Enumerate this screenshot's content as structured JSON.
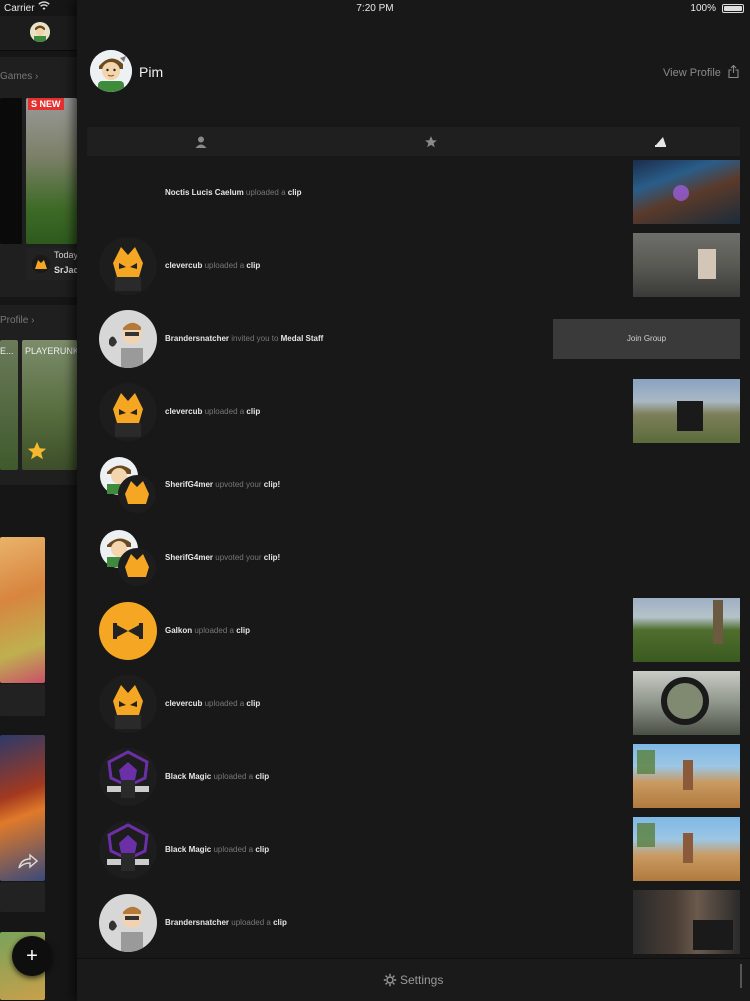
{
  "status_bar": {
    "carrier": "Carrier",
    "time": "7:20 PM",
    "battery": "100%"
  },
  "left": {
    "games_link": "Games",
    "new_badge": "S NEW",
    "today_label": "Today",
    "user_short": "SrJac",
    "profile_link": "Profile",
    "clip_title": "PLAYERUNK",
    "clip_title_left": "E..."
  },
  "panel": {
    "name": "Pim",
    "view_profile": "View Profile",
    "tabs": [
      "person-icon",
      "star-icon",
      "bullhorn-icon"
    ],
    "settings_label": "Settings",
    "join_button": "Join Group",
    "feed": [
      {
        "user": "Noctis Lucis Caelum",
        "action": "uploaded a",
        "object": "clip"
      },
      {
        "user": "clevercub",
        "action": "uploaded a",
        "object": "clip"
      },
      {
        "user": "Brandersnatcher",
        "action": "invited you to",
        "object": "Medal Staff"
      },
      {
        "user": "clevercub",
        "action": "uploaded a",
        "object": "clip"
      },
      {
        "user": "SherifG4mer",
        "action": "upvoted your",
        "object": "clip!"
      },
      {
        "user": "SherifG4mer",
        "action": "upvoted your",
        "object": "clip!"
      },
      {
        "user": "Galkon",
        "action": "uploaded a",
        "object": "clip"
      },
      {
        "user": "clevercub",
        "action": "uploaded a",
        "object": "clip"
      },
      {
        "user": "Black Magic",
        "action": "uploaded a",
        "object": "clip"
      },
      {
        "user": "Black Magic",
        "action": "uploaded a",
        "object": "clip"
      },
      {
        "user": "Brandersnatcher",
        "action": "uploaded a",
        "object": "clip"
      }
    ]
  },
  "colors": {
    "accent_orange": "#f5a623",
    "new_red": "#e53030",
    "purple": "#6b2fa8"
  }
}
